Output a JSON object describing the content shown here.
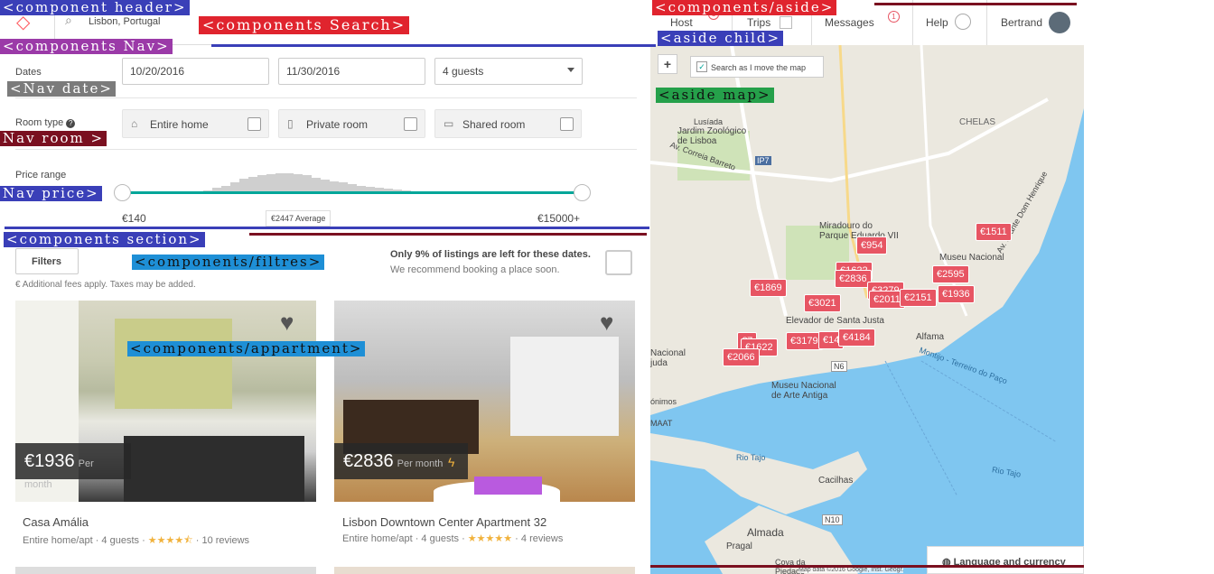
{
  "header": {
    "location": "Lisbon, Portugal",
    "nav": {
      "host": "Host",
      "trips": "Trips",
      "messages": "Messages",
      "help": "Help",
      "user": "Bertrand"
    }
  },
  "filters": {
    "dates_label": "Dates",
    "checkin": "10/20/2016",
    "checkout": "11/30/2016",
    "guests": "4 guests",
    "room_type_label": "Room type",
    "rooms": [
      "Entire home",
      "Private room",
      "Shared room"
    ],
    "price_label": "Price range",
    "price_min": "€140",
    "price_max": "€15000+",
    "price_avg": "€2447 Average",
    "filters_button": "Filters",
    "fees_note": "Additional fees apply. Taxes may be added.",
    "scarcity_title": "Only 9% of listings are left for these dates.",
    "scarcity_sub": "We recommend booking a place soon."
  },
  "listings": [
    {
      "title": "Casa Amália",
      "price": "€1936",
      "per": "Per month",
      "meta": "Entire home/apt · 4 guests ·",
      "reviews": "· 10 reviews",
      "rating": 4.5
    },
    {
      "title": "Lisbon Downtown Center Apartment 32",
      "price": "€2836",
      "per": "Per month",
      "meta": "Entire home/apt · 4 guests ·",
      "reviews": "· 4 reviews",
      "rating": 5
    }
  ],
  "map": {
    "search_toggle": "Search as I move the map",
    "zoom_in": "+",
    "language": "Language and currency",
    "copyright": "Map data ©2016 Google, Inst. Geogr.",
    "labels": {
      "jardim": "Jardim Zoológico\nde Lisboa",
      "chelas": "CHELAS",
      "miradouro": "Miradouro do\nParque Eduardo VII",
      "museu_nacional": "Museu Nacional",
      "elevador": "Elevador de Santa Justa",
      "alfama": "Alfama",
      "museu_arte": "Museu Nacional\nde Arte Antiga",
      "rio_tajo": "Rio Tajo",
      "rio_tajo2": "Rio Tajo",
      "almada": "Almada",
      "cacilhas": "Cacilhas",
      "pragal": "Pragal",
      "maat": "MAAT",
      "lusiada": "Lusíada",
      "nacional": "Nacional\njuda",
      "onimos": "ónimos",
      "montijo": "Montijo - Terreiro do Paço",
      "av_correia": "Av. Correia Barreto",
      "chelas_av": "Av. Infante Dom Henrique",
      "ip7": "IP7",
      "n6": "N6",
      "n10": "N10",
      "cova": "Cova da\nPiedade"
    },
    "pins": [
      "€1511",
      "€954",
      "€2595",
      "€1869",
      "€2836",
      "€3279",
      "€1936",
      "€2011",
      "€2151",
      "€3021",
      "€1622",
      "€3179",
      "€4184",
      "€2066",
      "€7",
      "€14"
    ]
  },
  "annotations": {
    "header": "<component header>",
    "search": "<components Search>",
    "nav": "<components Nav>",
    "aside": "<components/aside>",
    "aside_child": "<aside child>",
    "nav_date": "<Nav date>",
    "aside_map": "<aside map>",
    "nav_room": "Nav room >",
    "nav_price": "Nav price>",
    "section": "<components section>",
    "filtres": "<components/filtres>",
    "appartment": "<components/appartment>"
  },
  "colors": {
    "accent": "#ff5a5f",
    "pin": "#e75563",
    "slider": "#00a699",
    "water": "#7fc6f0"
  }
}
